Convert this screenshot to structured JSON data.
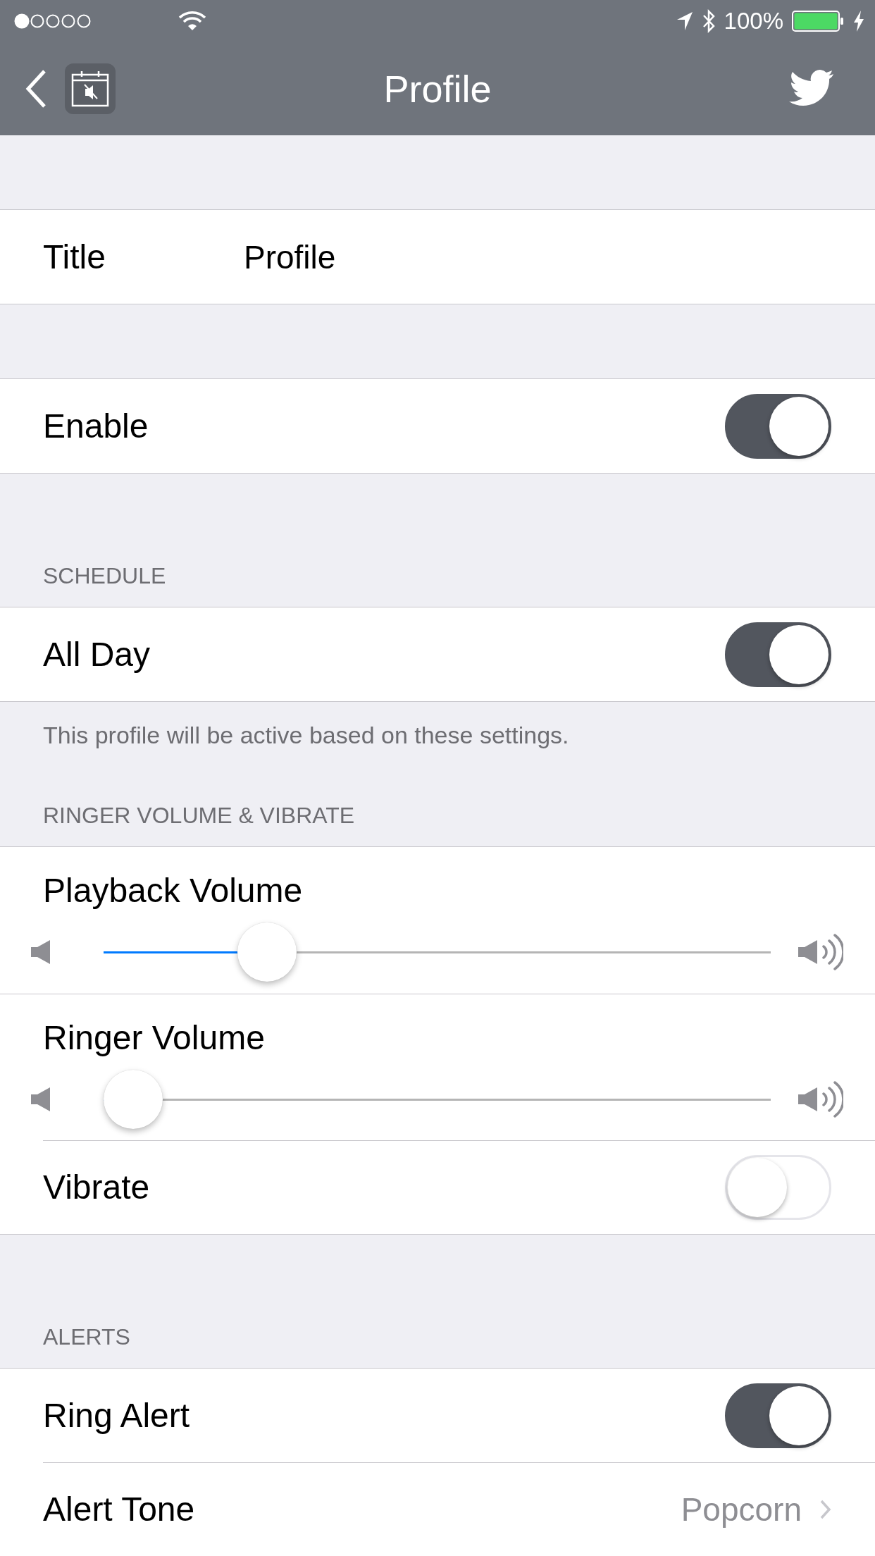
{
  "status_bar": {
    "battery": "100%"
  },
  "nav_bar": {
    "title": "Profile"
  },
  "sections": [
    {
      "rows": [
        {
          "kind": "value",
          "label": "Title",
          "value": "Profile"
        }
      ]
    },
    {
      "rows": [
        {
          "kind": "switch",
          "label": "Enable",
          "on": true
        }
      ]
    },
    {
      "header": "SCHEDULE",
      "rows": [
        {
          "kind": "switch",
          "label": "All Day",
          "on": true
        }
      ],
      "footer": "This profile will be active based on these settings."
    },
    {
      "header": "RINGER VOLUME & VIBRATE",
      "rows": [
        {
          "kind": "slider",
          "label": "Playback Volume",
          "level": 0.22
        },
        {
          "kind": "slider",
          "label": "Ringer Volume",
          "level": 0
        },
        {
          "kind": "switch",
          "label": "Vibrate",
          "on": false
        }
      ]
    },
    {
      "header": "ALERTS",
      "rows": [
        {
          "kind": "switch",
          "label": "Ring Alert",
          "on": true
        },
        {
          "kind": "disclosure",
          "label": "Alert Tone",
          "value": "Popcorn"
        }
      ]
    }
  ]
}
